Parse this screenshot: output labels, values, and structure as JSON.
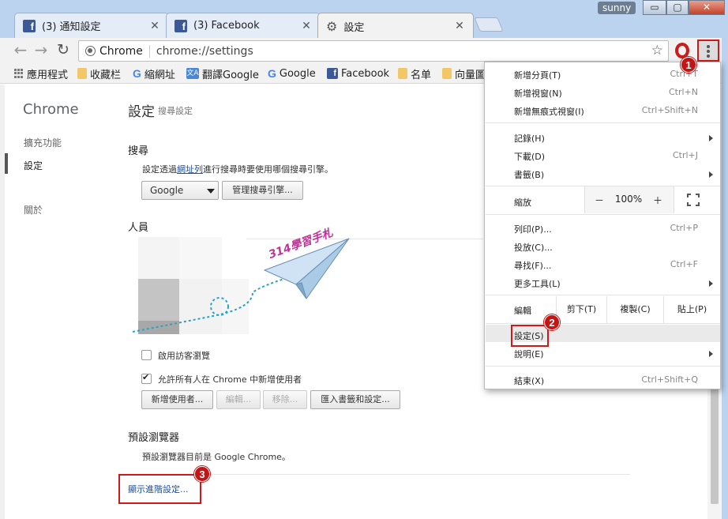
{
  "window": {
    "user_badge": "sunny",
    "minimize": "▭",
    "maximize": "▢",
    "close": "✕"
  },
  "tabs": [
    {
      "label": "(3) 通知設定",
      "icon": "facebook-icon"
    },
    {
      "label": "(3) Facebook",
      "icon": "facebook-icon"
    },
    {
      "label": "設定",
      "icon": "gear-icon",
      "active": true
    }
  ],
  "tab_close": "✕",
  "toolbar": {
    "back": "←",
    "forward": "→",
    "reload": "↻",
    "chip": "Chrome",
    "url": "chrome://settings",
    "star": "☆"
  },
  "bookmarks": [
    {
      "label": "應用程式",
      "icon": "apps-icon"
    },
    {
      "label": "收藏栏",
      "icon": "folder-icon"
    },
    {
      "label": "縮網址",
      "icon": "google-icon"
    },
    {
      "label": "翻譯Google",
      "icon": "translate-icon"
    },
    {
      "label": "Google",
      "icon": "google-icon"
    },
    {
      "label": "Facebook",
      "icon": "facebook-icon"
    },
    {
      "label": "名单",
      "icon": "folder-icon"
    },
    {
      "label": "向量圖",
      "icon": "folder-icon"
    }
  ],
  "sidebar": {
    "brand": "Chrome",
    "items": [
      {
        "label": "擴充功能"
      },
      {
        "label": "設定"
      },
      {
        "label": "關於"
      }
    ]
  },
  "settings": {
    "title": "設定",
    "search_placeholder": "搜尋設定",
    "search_section": {
      "heading": "搜尋",
      "desc_before": "設定透過",
      "desc_link": "網址列",
      "desc_after": "進行搜尋時要使用哪個搜尋引擎。",
      "engine_value": "Google",
      "manage_button": "管理搜尋引擎..."
    },
    "people_section": {
      "heading": "人員",
      "guest_label": "啟用訪客瀏覽",
      "allow_label": "允許所有人在 Chrome 中新增使用者",
      "add_user": "新增使用者...",
      "edit": "編輯...",
      "remove": "移除...",
      "import": "匯入書籤和設定..."
    },
    "default_browser": {
      "heading": "預設瀏覽器",
      "desc": "預設瀏覽器目前是 Google Chrome。"
    },
    "advanced_link": "顯示進階設定..."
  },
  "watermark": "314學習手札",
  "menu": {
    "new_tab": "新增分頁(T)",
    "new_tab_sc": "Ctrl+T",
    "new_window": "新增視窗(N)",
    "new_window_sc": "Ctrl+N",
    "incognito": "新增無痕式視窗(I)",
    "incognito_sc": "Ctrl+Shift+N",
    "history": "記錄(H)",
    "downloads": "下載(D)",
    "downloads_sc": "Ctrl+J",
    "bookmarks": "書籤(B)",
    "zoom_label": "縮放",
    "zoom_minus": "－",
    "zoom_value": "100%",
    "zoom_plus": "＋",
    "print": "列印(P)...",
    "print_sc": "Ctrl+P",
    "cast": "投放(C)...",
    "find": "尋找(F)...",
    "find_sc": "Ctrl+F",
    "more_tools": "更多工具(L)",
    "edit_label": "編輯",
    "cut": "剪下(T)",
    "copy": "複製(C)",
    "paste": "貼上(P)",
    "settings": "設定(S)",
    "help": "說明(E)",
    "exit": "結束(X)",
    "exit_sc": "Ctrl+Shift+Q"
  },
  "badges": {
    "one": "1",
    "two": "2",
    "three": "3"
  },
  "colors": {
    "accent_red": "#c41515",
    "link": "#1a4fa3",
    "titlebar": "#bcd3f0"
  }
}
